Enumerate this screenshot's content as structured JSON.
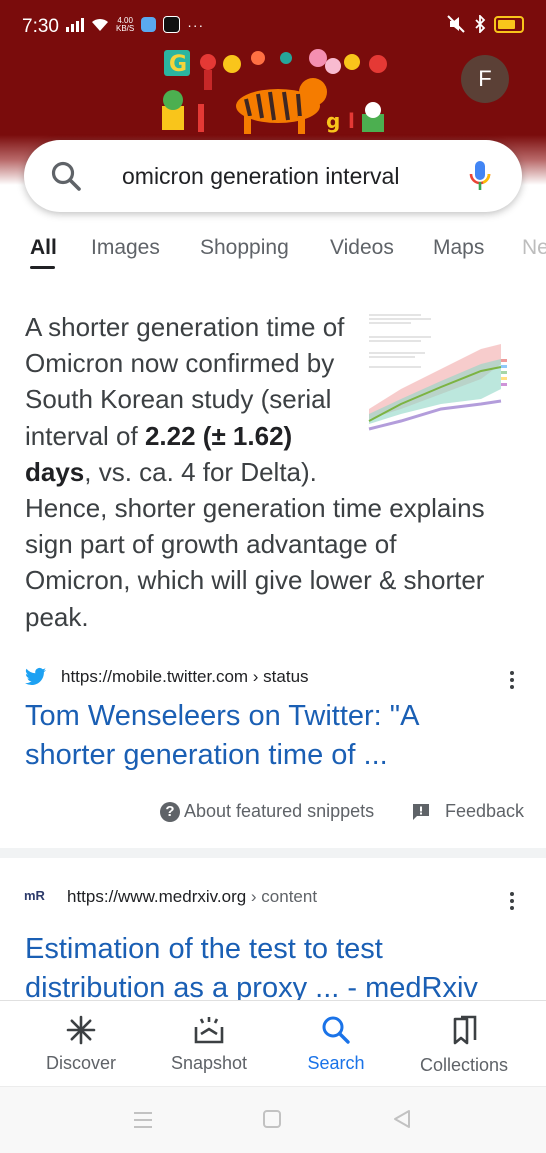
{
  "status_bar": {
    "time": "7:30",
    "net_speed_value": "4.00",
    "net_speed_unit": "KB/S",
    "more": "···"
  },
  "account": {
    "avatar_letter": "F"
  },
  "doodle": {
    "letters": [
      "G",
      "g",
      "l",
      "e"
    ]
  },
  "search": {
    "query": "omicron generation interval"
  },
  "tabs": [
    {
      "label": "All",
      "active": true
    },
    {
      "label": "Images"
    },
    {
      "label": "Shopping"
    },
    {
      "label": "Videos"
    },
    {
      "label": "Maps"
    },
    {
      "label": "Ne"
    }
  ],
  "featured_snippet": {
    "text_1": "A shorter generation time of Omicron now confirmed by South Korean study (serial interval of ",
    "bold_1": "2.22 (± 1.62) days",
    "text_2": ", vs. ca. 4 for Delta). Hence, shorter generation time explains sign part of growth advantage of Omicron, which will give lower & shorter peak.",
    "source_url": "https://mobile.twitter.com",
    "source_crumb": " › status",
    "title_line_1": "Tom Wenseleers on Twitter: \"A",
    "title_line_2": "shorter generation time of ...",
    "about_label": "About featured snippets",
    "feedback_label": "Feedback"
  },
  "result_2": {
    "logo_text": "mR",
    "url": "https://www.medrxiv.org",
    "crumb": " › content",
    "title_line_1": "Estimation of the test to test",
    "title_line_2": "distribution as a proxy ... - medRxiv"
  },
  "bottom_nav": [
    {
      "label": "Discover",
      "icon": "asterisk-icon"
    },
    {
      "label": "Snapshot",
      "icon": "snapshot-icon"
    },
    {
      "label": "Search",
      "icon": "search-icon",
      "active": true
    },
    {
      "label": "Collections",
      "icon": "collections-icon"
    }
  ],
  "colors": {
    "banner": "#7a0c0c",
    "link_blue": "#1a5fb4",
    "active_nav": "#1a73e8"
  }
}
